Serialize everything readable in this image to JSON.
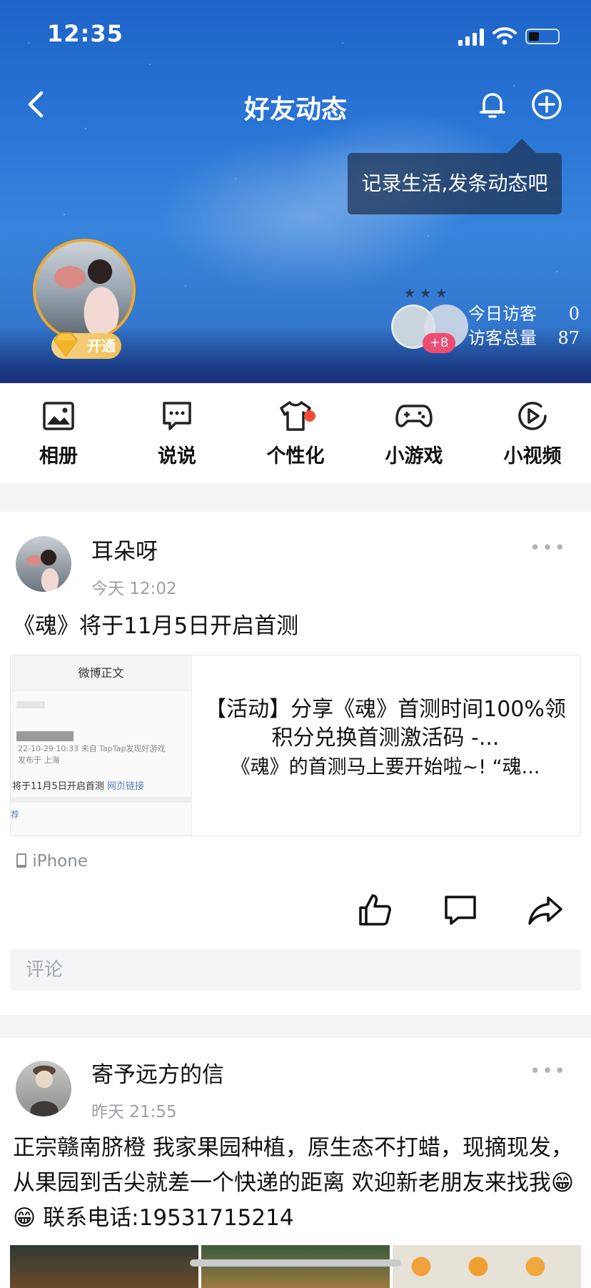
{
  "status_bar": {
    "time": "12:35"
  },
  "navbar": {
    "title": "好友动态"
  },
  "tooltip": {
    "text": "记录生活,发条动态吧"
  },
  "profile": {
    "vip_label": "开通"
  },
  "visitors": {
    "badge": "+8",
    "today_label": "今日访客",
    "today_value": "0",
    "total_label": "访客总量",
    "total_value": "87"
  },
  "menu": {
    "items": [
      {
        "label": "相册",
        "icon": "album-icon"
      },
      {
        "label": "说说",
        "icon": "message-icon"
      },
      {
        "label": "个性化",
        "icon": "tshirt-icon"
      },
      {
        "label": "小游戏",
        "icon": "gamepad-icon"
      },
      {
        "label": "小视频",
        "icon": "play-icon"
      }
    ]
  },
  "posts": [
    {
      "author": "耳朵呀",
      "time": "今天 12:02",
      "text": "《魂》将于11月5日开启首测",
      "share_card": {
        "thumb_header": "微博正文",
        "thumb_meta": "22-10-29 10:33  来自 TapTap发现好游戏",
        "thumb_location": "发布于 上海",
        "thumb_text": "将于11月5日开启首测",
        "thumb_link": "网页链接",
        "thumb_tag": "荐",
        "title": "【活动】分享《魂》首测时间100%领积分兑换首测激活码 -...",
        "summary": "《魂》的首测马上要开始啦~! “魂..."
      },
      "device": "iPhone",
      "comment_placeholder": "评论"
    },
    {
      "author": "寄予远方的信",
      "time": "昨天 21:55",
      "text": "正宗赣南脐橙   我家果园种植，原生态不打蜡，现摘现发，从果园到舌尖就差一个快递的距离   欢迎新老朋友来找我😁😁 联系电话:19531715214"
    }
  ],
  "colors": {
    "accent": "#2a76d6",
    "badge": "#ee4d72",
    "vip": "#f1c05a",
    "dot": "#f24b3a"
  }
}
